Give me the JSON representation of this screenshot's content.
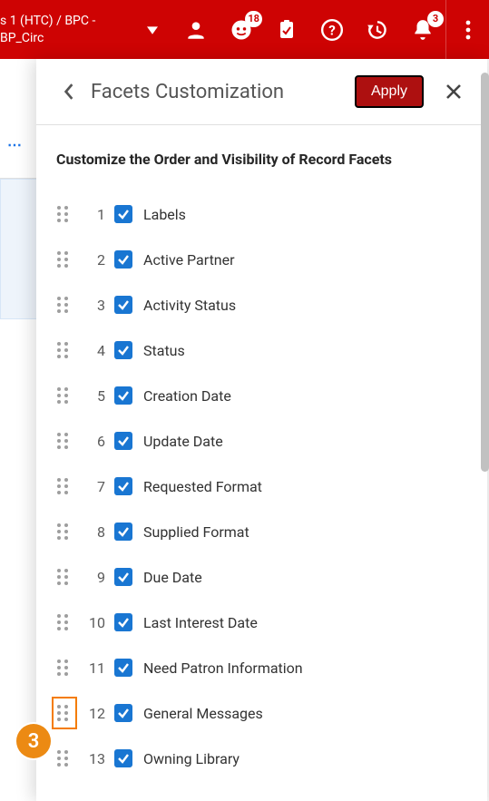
{
  "appbar": {
    "title_line1": "s 1 (HTC) / BPC -",
    "title_line2": "BP_Circ",
    "badges": {
      "tasks": "18",
      "notifications": "3"
    }
  },
  "panel": {
    "title": "Facets Customization",
    "apply_label": "Apply",
    "instruction": "Customize the Order and Visibility of Record Facets"
  },
  "facets": [
    {
      "index": "1",
      "label": "Labels",
      "checked": true
    },
    {
      "index": "2",
      "label": "Active Partner",
      "checked": true
    },
    {
      "index": "3",
      "label": "Activity Status",
      "checked": true
    },
    {
      "index": "4",
      "label": "Status",
      "checked": true
    },
    {
      "index": "5",
      "label": "Creation Date",
      "checked": true
    },
    {
      "index": "6",
      "label": "Update Date",
      "checked": true
    },
    {
      "index": "7",
      "label": "Requested Format",
      "checked": true
    },
    {
      "index": "8",
      "label": "Supplied Format",
      "checked": true
    },
    {
      "index": "9",
      "label": "Due Date",
      "checked": true
    },
    {
      "index": "10",
      "label": "Last Interest Date",
      "checked": true
    },
    {
      "index": "11",
      "label": "Need Patron Information",
      "checked": true
    },
    {
      "index": "12",
      "label": "General Messages",
      "checked": true,
      "highlight": true
    },
    {
      "index": "13",
      "label": "Owning Library",
      "checked": true
    }
  ],
  "annotation": {
    "number": "3"
  }
}
